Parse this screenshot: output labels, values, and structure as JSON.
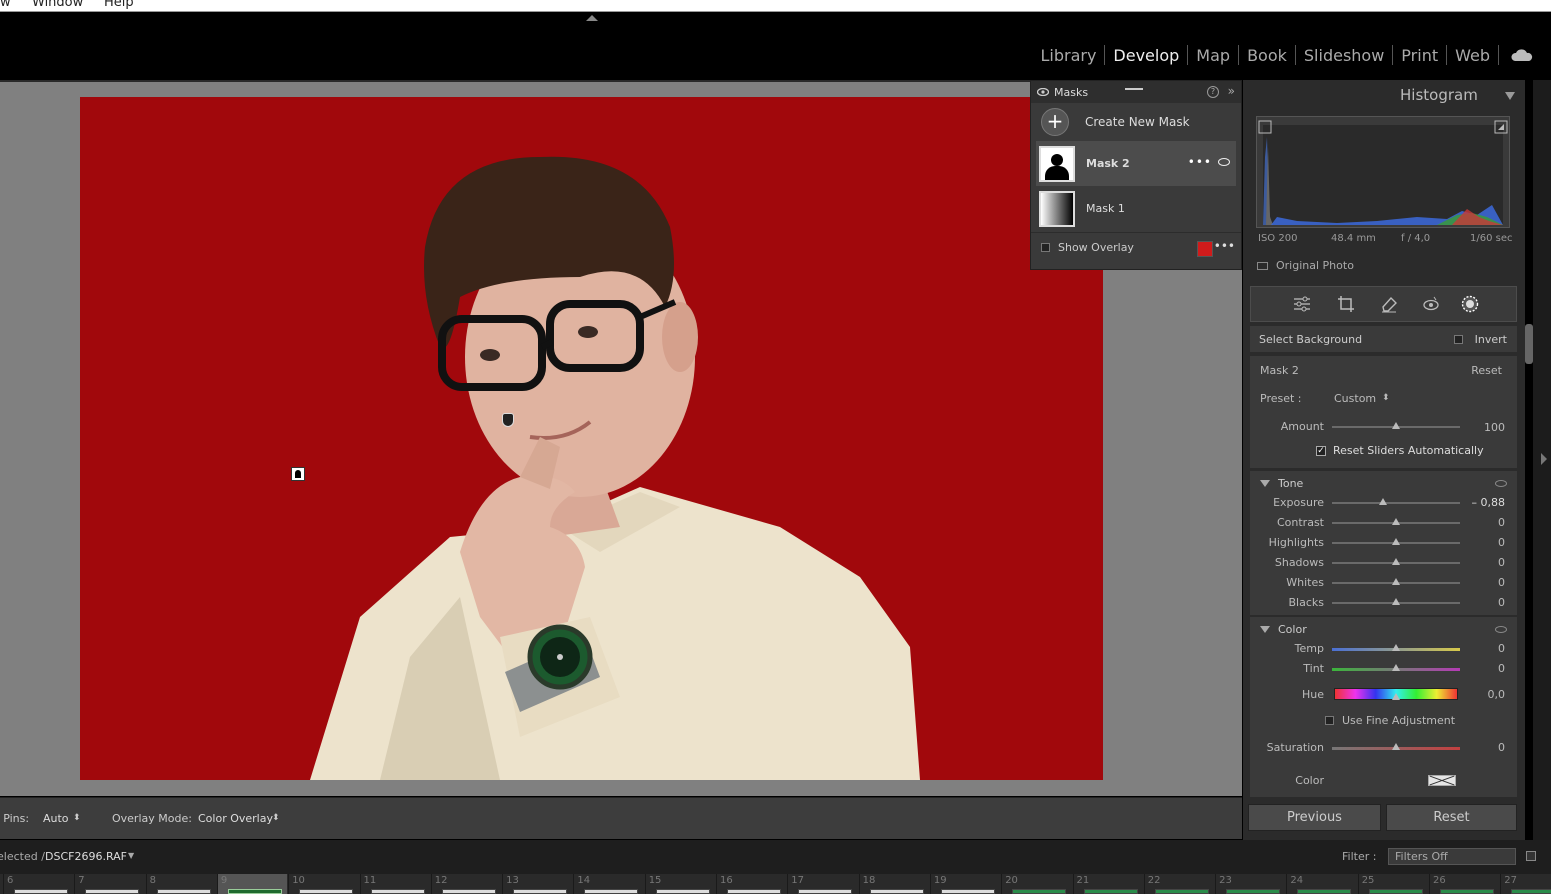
{
  "os_menu": {
    "items": [
      "w",
      "Window",
      "Help"
    ]
  },
  "modules": [
    "Library",
    "Develop",
    "Map",
    "Book",
    "Slideshow",
    "Print",
    "Web"
  ],
  "active_module": "Develop",
  "masks_panel": {
    "title": "Masks",
    "create_label": "Create New Mask",
    "masks": [
      {
        "name": "Mask 2",
        "thumb": "person",
        "selected": true
      },
      {
        "name": "Mask 1",
        "thumb": "gradient",
        "selected": false
      }
    ],
    "show_overlay_label": "Show Overlay",
    "overlay_color": "#d01b1b"
  },
  "toolbar": {
    "pins_label": ": Pins:",
    "pins_value": "Auto",
    "overlay_mode_label": "Overlay Mode:",
    "overlay_mode_value": "Color Overlay"
  },
  "histogram": {
    "title": "Histogram",
    "iso": "ISO 200",
    "focal": "48.4 mm",
    "aperture": "f / 4,0",
    "shutter": "1/60 sec",
    "original_photo_label": "Original Photo"
  },
  "mask_settings": {
    "select_label": "Select Background",
    "invert_label": "Invert",
    "mask_name": "Mask 2",
    "reset_label": "Reset",
    "preset_label": "Preset :",
    "preset_value": "Custom",
    "amount_label": "Amount",
    "amount_value": "100",
    "reset_sliders_label": "Reset Sliders Automatically"
  },
  "tone": {
    "title": "Tone",
    "sliders": [
      {
        "label": "Exposure",
        "value": "– 0,88",
        "pos": 0.4
      },
      {
        "label": "Contrast",
        "value": "0",
        "pos": 0.5
      },
      {
        "label": "Highlights",
        "value": "0",
        "pos": 0.5
      },
      {
        "label": "Shadows",
        "value": "0",
        "pos": 0.5
      },
      {
        "label": "Whites",
        "value": "0",
        "pos": 0.5
      },
      {
        "label": "Blacks",
        "value": "0",
        "pos": 0.5
      }
    ]
  },
  "color": {
    "title": "Color",
    "temp_label": "Temp",
    "temp_value": "0",
    "tint_label": "Tint",
    "tint_value": "0",
    "hue_label": "Hue",
    "hue_value": "0,0",
    "fine_label": "Use Fine Adjustment",
    "saturation_label": "Saturation",
    "saturation_value": "0",
    "color_label": "Color"
  },
  "buttons": {
    "previous": "Previous",
    "reset": "Reset"
  },
  "filmstrip_header": {
    "selected_prefix": "elected /",
    "filename": "DSCF2696.RAF",
    "filter_label": "Filter :",
    "filter_value": "Filters Off"
  },
  "filmstrip": {
    "numbers": [
      "6",
      "7",
      "8",
      "9",
      "10",
      "11",
      "12",
      "13",
      "14",
      "15",
      "16",
      "17",
      "18",
      "19",
      "20",
      "21",
      "22",
      "23",
      "24",
      "25",
      "26",
      "27"
    ],
    "current": "9"
  }
}
